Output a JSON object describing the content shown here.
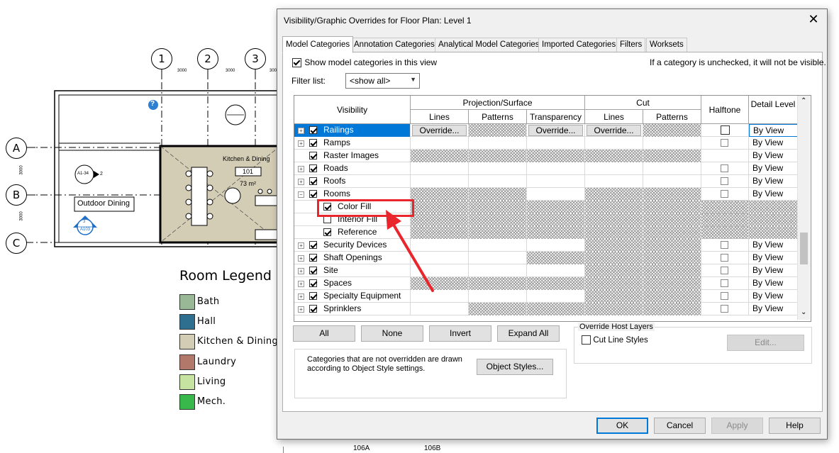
{
  "plan": {
    "grid_cols": [
      "1",
      "2",
      "3"
    ],
    "grid_rows": [
      "A",
      "B",
      "C"
    ],
    "dims": [
      "3000",
      "3000",
      "3000",
      "3000",
      "3000"
    ],
    "room_name": "Kitchen & Dining",
    "room_number": "101",
    "room_area": "73 m²",
    "outdoor_label": "Outdoor Dining",
    "elev_tag_top": "A1-34",
    "elev_tag_num": "2",
    "section_tag_top": "3",
    "section_tag_bottom": "A103",
    "door_tags": [
      "106A",
      "106B"
    ]
  },
  "legend": {
    "title": "Room Legend",
    "items": [
      {
        "label": "Bath",
        "color": "#99b896"
      },
      {
        "label": "Hall",
        "color": "#2e6f90"
      },
      {
        "label": "Kitchen & Dining",
        "color": "#d4cdb6"
      },
      {
        "label": "Laundry",
        "color": "#b2786a"
      },
      {
        "label": "Living",
        "color": "#c6e3a1"
      },
      {
        "label": "Mech.",
        "color": "#38b84a"
      }
    ]
  },
  "dialog": {
    "title": "Visibility/Graphic Overrides for Floor Plan: Level 1",
    "close": "✕",
    "tabs": [
      "Model Categories",
      "Annotation Categories",
      "Analytical Model Categories",
      "Imported Categories",
      "Filters",
      "Worksets"
    ],
    "show_categories_label": "Show model categories in this view",
    "hint": "If a category is unchecked, it will not be visible.",
    "filter_label": "Filter list:",
    "filter_value": "<show all>",
    "headers": {
      "visibility": "Visibility",
      "projection": "Projection/Surface",
      "cut": "Cut",
      "lines": "Lines",
      "patterns": "Patterns",
      "transparency": "Transparency",
      "halftone": "Halftone",
      "detail_level": "Detail Level"
    },
    "override_label": "Override...",
    "rows": [
      {
        "name": "Railings",
        "expand": "+",
        "checked": true,
        "halftone": true,
        "detail": "By View",
        "indent": 0,
        "selected": true
      },
      {
        "name": "Ramps",
        "expand": "+",
        "checked": true,
        "halftone": true,
        "detail": "By View",
        "indent": 0
      },
      {
        "name": "Raster Images",
        "expand": "",
        "checked": true,
        "halftone": false,
        "detail": "By View",
        "indent": 0
      },
      {
        "name": "Roads",
        "expand": "+",
        "checked": true,
        "halftone": true,
        "detail": "By View",
        "indent": 0
      },
      {
        "name": "Roofs",
        "expand": "+",
        "checked": true,
        "halftone": true,
        "detail": "By View",
        "indent": 0
      },
      {
        "name": "Rooms",
        "expand": "-",
        "checked": true,
        "halftone": true,
        "detail": "By View",
        "indent": 0
      },
      {
        "name": "Color Fill",
        "expand": "",
        "checked": true,
        "halftone": false,
        "detail": "",
        "indent": 1,
        "highlight": true
      },
      {
        "name": "Interior Fill",
        "expand": "",
        "checked": false,
        "halftone": false,
        "detail": "",
        "indent": 1
      },
      {
        "name": "Reference",
        "expand": "",
        "checked": true,
        "halftone": false,
        "detail": "",
        "indent": 1
      },
      {
        "name": "Security Devices",
        "expand": "+",
        "checked": true,
        "halftone": true,
        "detail": "By View",
        "indent": 0
      },
      {
        "name": "Shaft Openings",
        "expand": "+",
        "checked": true,
        "halftone": true,
        "detail": "By View",
        "indent": 0
      },
      {
        "name": "Site",
        "expand": "+",
        "checked": true,
        "halftone": true,
        "detail": "By View",
        "indent": 0
      },
      {
        "name": "Spaces",
        "expand": "+",
        "checked": true,
        "halftone": true,
        "detail": "By View",
        "indent": 0
      },
      {
        "name": "Specialty Equipment",
        "expand": "+",
        "checked": true,
        "halftone": true,
        "detail": "By View",
        "indent": 0
      },
      {
        "name": "Sprinklers",
        "expand": "+",
        "checked": true,
        "halftone": true,
        "detail": "By View",
        "indent": 0
      }
    ],
    "buttons": {
      "all": "All",
      "none": "None",
      "invert": "Invert",
      "expand_all": "Expand All",
      "object_styles": "Object Styles...",
      "edit": "Edit...",
      "ok": "OK",
      "cancel": "Cancel",
      "apply": "Apply",
      "help": "Help"
    },
    "override_host_title": "Override Host Layers",
    "cut_line_styles": "Cut Line Styles",
    "note": "Categories that are not overridden are drawn according to Object Style settings."
  }
}
